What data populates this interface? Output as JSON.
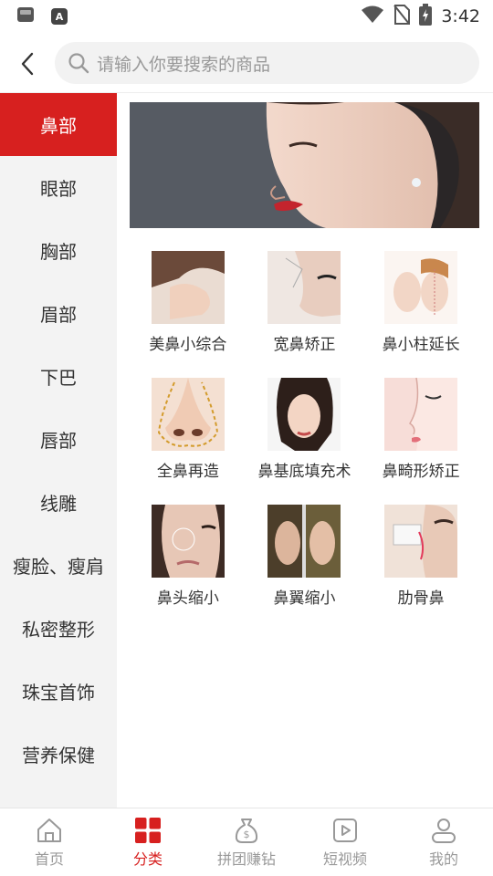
{
  "status_bar": {
    "time": "3:42",
    "app_icon_letter": "A"
  },
  "search": {
    "placeholder": "请输入你要搜索的商品"
  },
  "sidebar": {
    "items": [
      {
        "label": "鼻部",
        "active": true
      },
      {
        "label": "眼部"
      },
      {
        "label": "胸部"
      },
      {
        "label": "眉部"
      },
      {
        "label": "下巴"
      },
      {
        "label": "唇部"
      },
      {
        "label": "线雕"
      },
      {
        "label": "瘦脸、瘦肩"
      },
      {
        "label": "私密整形"
      },
      {
        "label": "珠宝首饰"
      },
      {
        "label": "营养保健"
      }
    ]
  },
  "categories": [
    {
      "label": "美鼻小综合",
      "icon": "nose-profile-photo"
    },
    {
      "label": "宽鼻矫正",
      "icon": "nose-closeup-photo"
    },
    {
      "label": "鼻小柱延长",
      "icon": "face-diagram-photo"
    },
    {
      "label": "全鼻再造",
      "icon": "nose-outline-photo"
    },
    {
      "label": "鼻基底填充术",
      "icon": "woman-portrait-photo"
    },
    {
      "label": "鼻畸形矫正",
      "icon": "nose-sketch-photo"
    },
    {
      "label": "鼻头缩小",
      "icon": "nose-tip-photo"
    },
    {
      "label": "鼻翼缩小",
      "icon": "before-after-photo"
    },
    {
      "label": "肋骨鼻",
      "icon": "rib-nose-photo"
    }
  ],
  "tabbar": {
    "items": [
      {
        "label": "首页",
        "icon": "home-icon"
      },
      {
        "label": "分类",
        "icon": "grid-icon",
        "active": true
      },
      {
        "label": "拼团赚钻",
        "icon": "money-bag-icon"
      },
      {
        "label": "短视频",
        "icon": "video-icon"
      },
      {
        "label": "我的",
        "icon": "user-icon"
      }
    ]
  },
  "colors": {
    "accent": "#d7201f",
    "sidebar_bg": "#f3f3f3",
    "inactive_text": "#999999"
  }
}
